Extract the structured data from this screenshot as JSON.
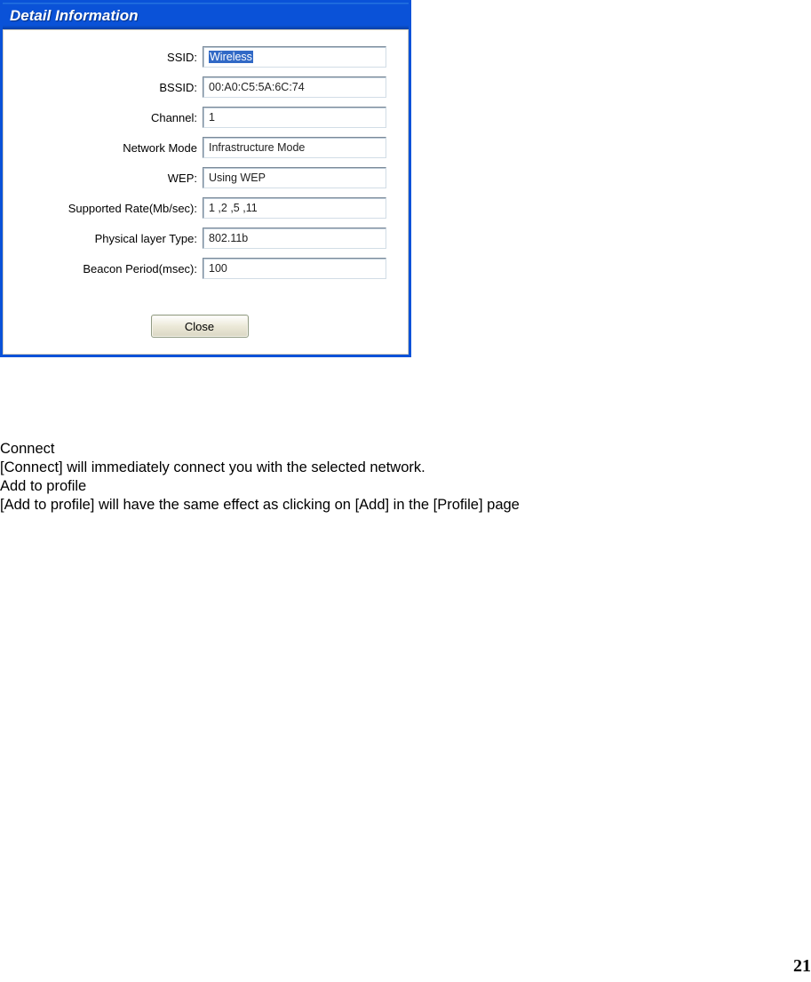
{
  "dialog": {
    "title": "Detail Information",
    "fields": {
      "ssid_label": "SSID:",
      "ssid_value": "Wireless",
      "bssid_label": "BSSID:",
      "bssid_value": "00:A0:C5:5A:6C:74",
      "channel_label": "Channel:",
      "channel_value": "1",
      "netmode_label": "Network Mode",
      "netmode_value": "Infrastructure Mode",
      "wep_label": "WEP:",
      "wep_value": "Using WEP",
      "rate_label": "Supported Rate(Mb/sec):",
      "rate_value": "1 ,2 ,5 ,11",
      "phy_label": "Physical layer Type:",
      "phy_value": "802.11b",
      "beacon_label": "Beacon Period(msec):",
      "beacon_value": "100"
    },
    "close_label": "Close"
  },
  "doc": {
    "connect_heading": "Connect",
    "connect_body": "[Connect] will immediately connect you with the selected network.",
    "add_heading": "Add to profile",
    "add_body": "[Add to profile] will have the same effect as clicking on [Add] in the [Profile] page"
  },
  "page_number": "21"
}
